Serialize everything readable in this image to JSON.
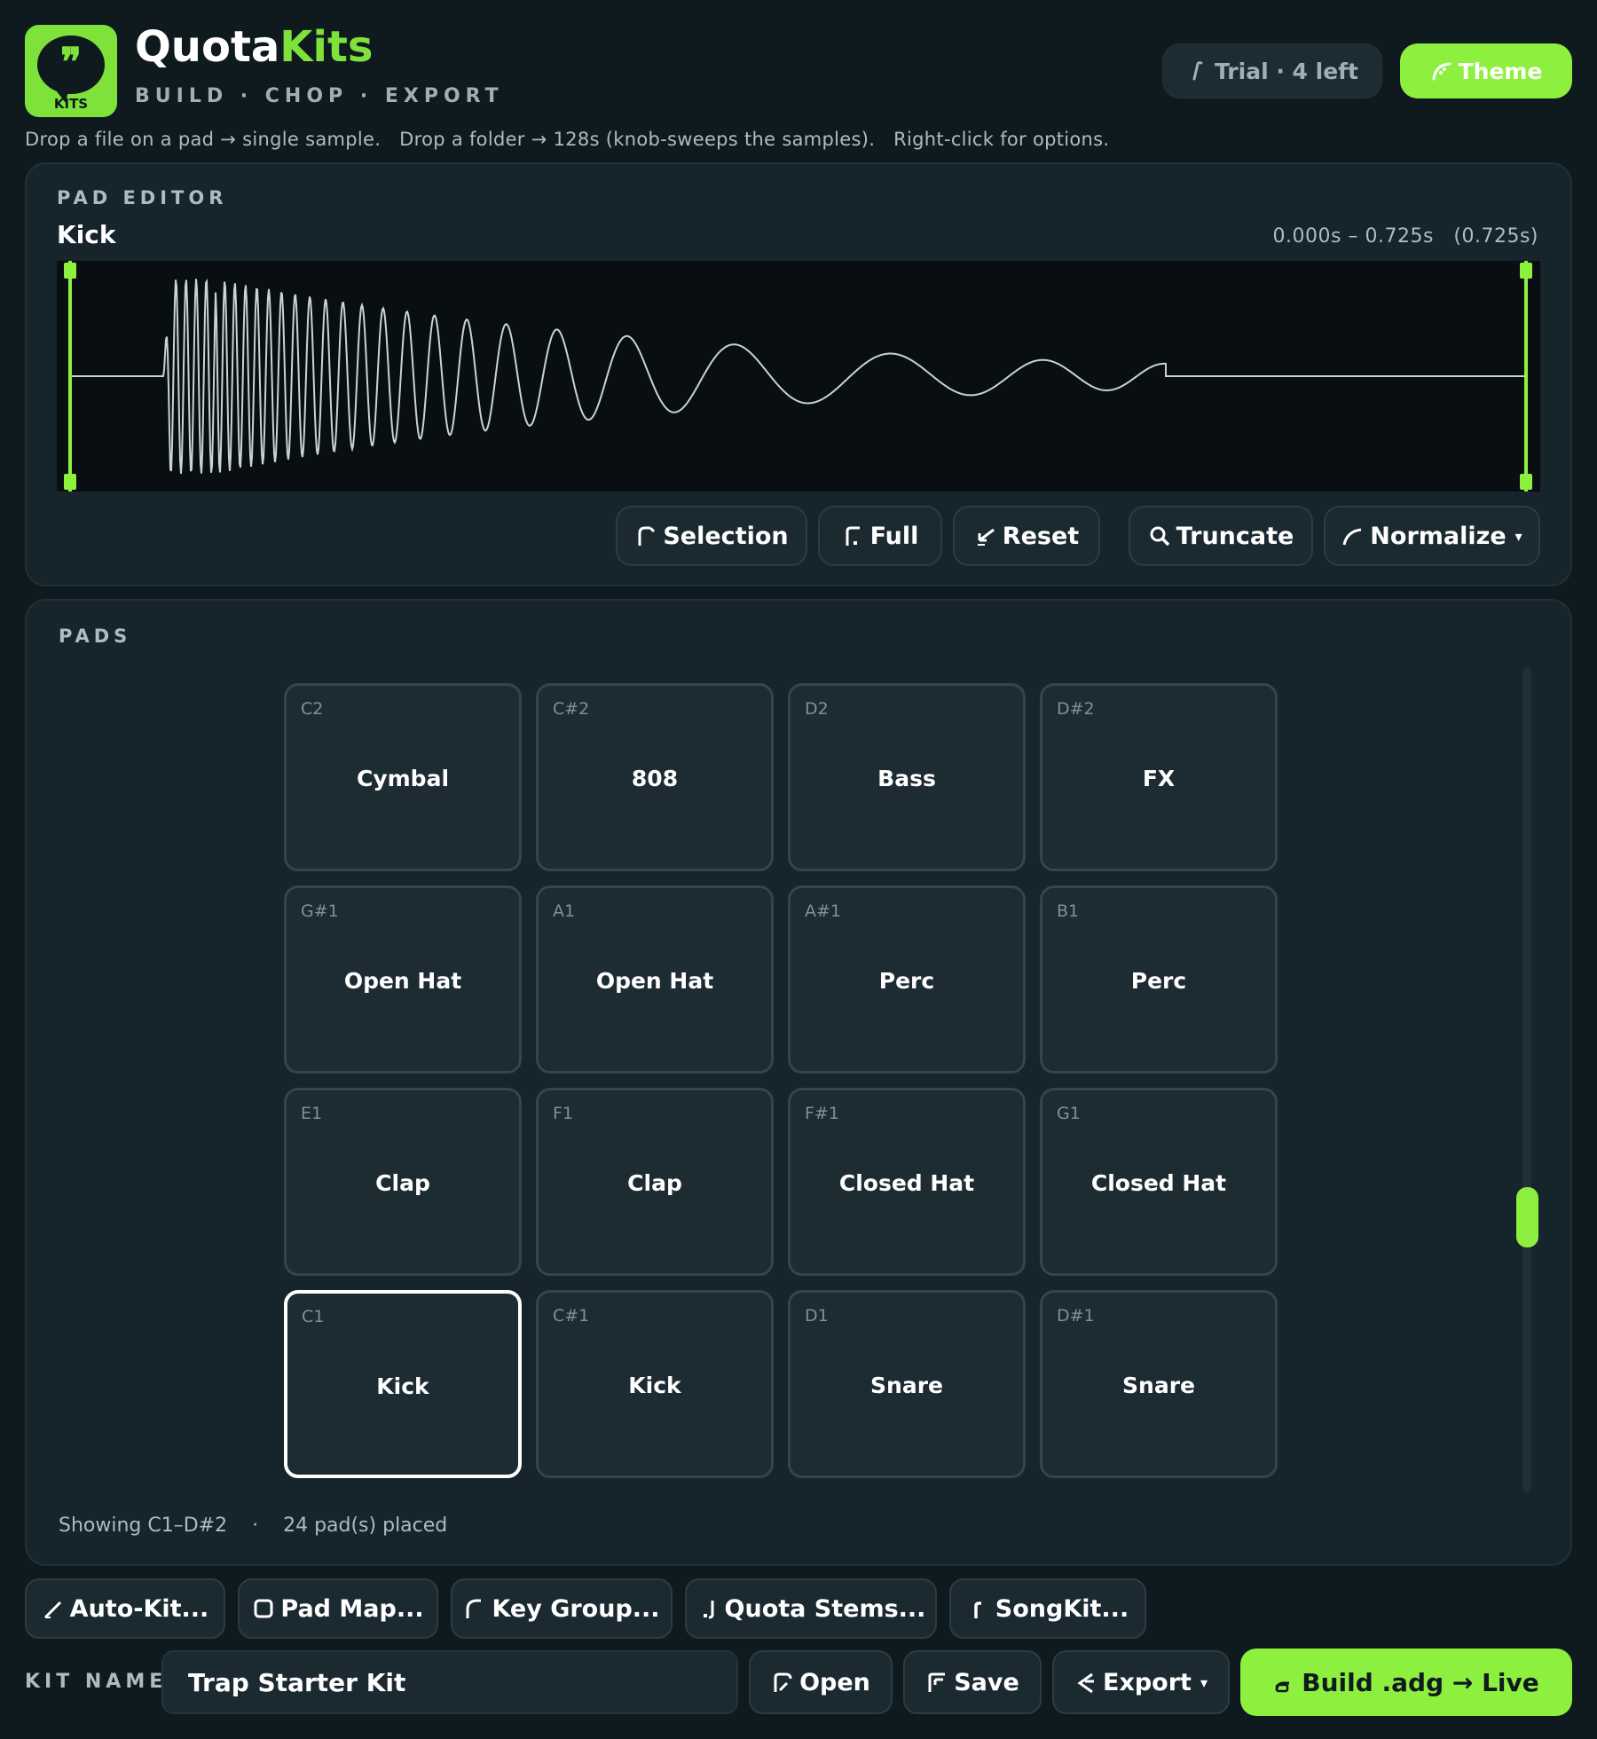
{
  "header": {
    "logo_badge": "KITS",
    "title_part1": "Quota",
    "title_part2": "Kits",
    "tagline": "BUILD · CHOP · EXPORT",
    "trial_label": "Trial · 4 left",
    "theme_label": "Theme",
    "hint": "Drop a file on a pad → single sample.   Drop a folder → 128s (knob-sweeps the samples).   Right-click for options."
  },
  "editor": {
    "section_label": "PAD EDITOR",
    "pad_name": "Kick",
    "time_range": "0.000s – 0.725s   (0.725s)",
    "buttons": {
      "selection": "Selection",
      "full": "Full",
      "reset": "Reset",
      "truncate": "Truncate",
      "normalize": "Normalize"
    },
    "normalize_caret": "▾"
  },
  "pads": {
    "section_label": "PADS",
    "grid": [
      [
        {
          "note": "C2",
          "name": "Cymbal"
        },
        {
          "note": "C#2",
          "name": "808"
        },
        {
          "note": "D2",
          "name": "Bass"
        },
        {
          "note": "D#2",
          "name": "FX"
        }
      ],
      [
        {
          "note": "G#1",
          "name": "Open Hat"
        },
        {
          "note": "A1",
          "name": "Open Hat"
        },
        {
          "note": "A#1",
          "name": "Perc"
        },
        {
          "note": "B1",
          "name": "Perc"
        }
      ],
      [
        {
          "note": "E1",
          "name": "Clap"
        },
        {
          "note": "F1",
          "name": "Clap"
        },
        {
          "note": "F#1",
          "name": "Closed Hat"
        },
        {
          "note": "G1",
          "name": "Closed Hat"
        }
      ],
      [
        {
          "note": "C1",
          "name": "Kick",
          "selected": true
        },
        {
          "note": "C#1",
          "name": "Kick"
        },
        {
          "note": "D1",
          "name": "Snare"
        },
        {
          "note": "D#1",
          "name": "Snare"
        }
      ]
    ],
    "showing": "Showing C1–D#2",
    "separator": "·",
    "placed": "24 pad(s) placed"
  },
  "toolbar": {
    "auto_kit": "Auto-Kit...",
    "pad_map": "Pad Map...",
    "key_group": "Key Group...",
    "quota_stems": "Quota Stems...",
    "songkit": "SongKit..."
  },
  "footer": {
    "kit_name_label": "KIT NAME",
    "kit_name_value": "Trap Starter Kit",
    "open": "Open",
    "save": "Save",
    "export": "Export",
    "export_caret": "▾",
    "build": "Build .adg → Live"
  },
  "colors": {
    "accent": "#8ef03e",
    "background": "#0f1a1f",
    "panel": "#16242b",
    "pad": "#1d2b33",
    "text_muted": "#aebcc0"
  }
}
